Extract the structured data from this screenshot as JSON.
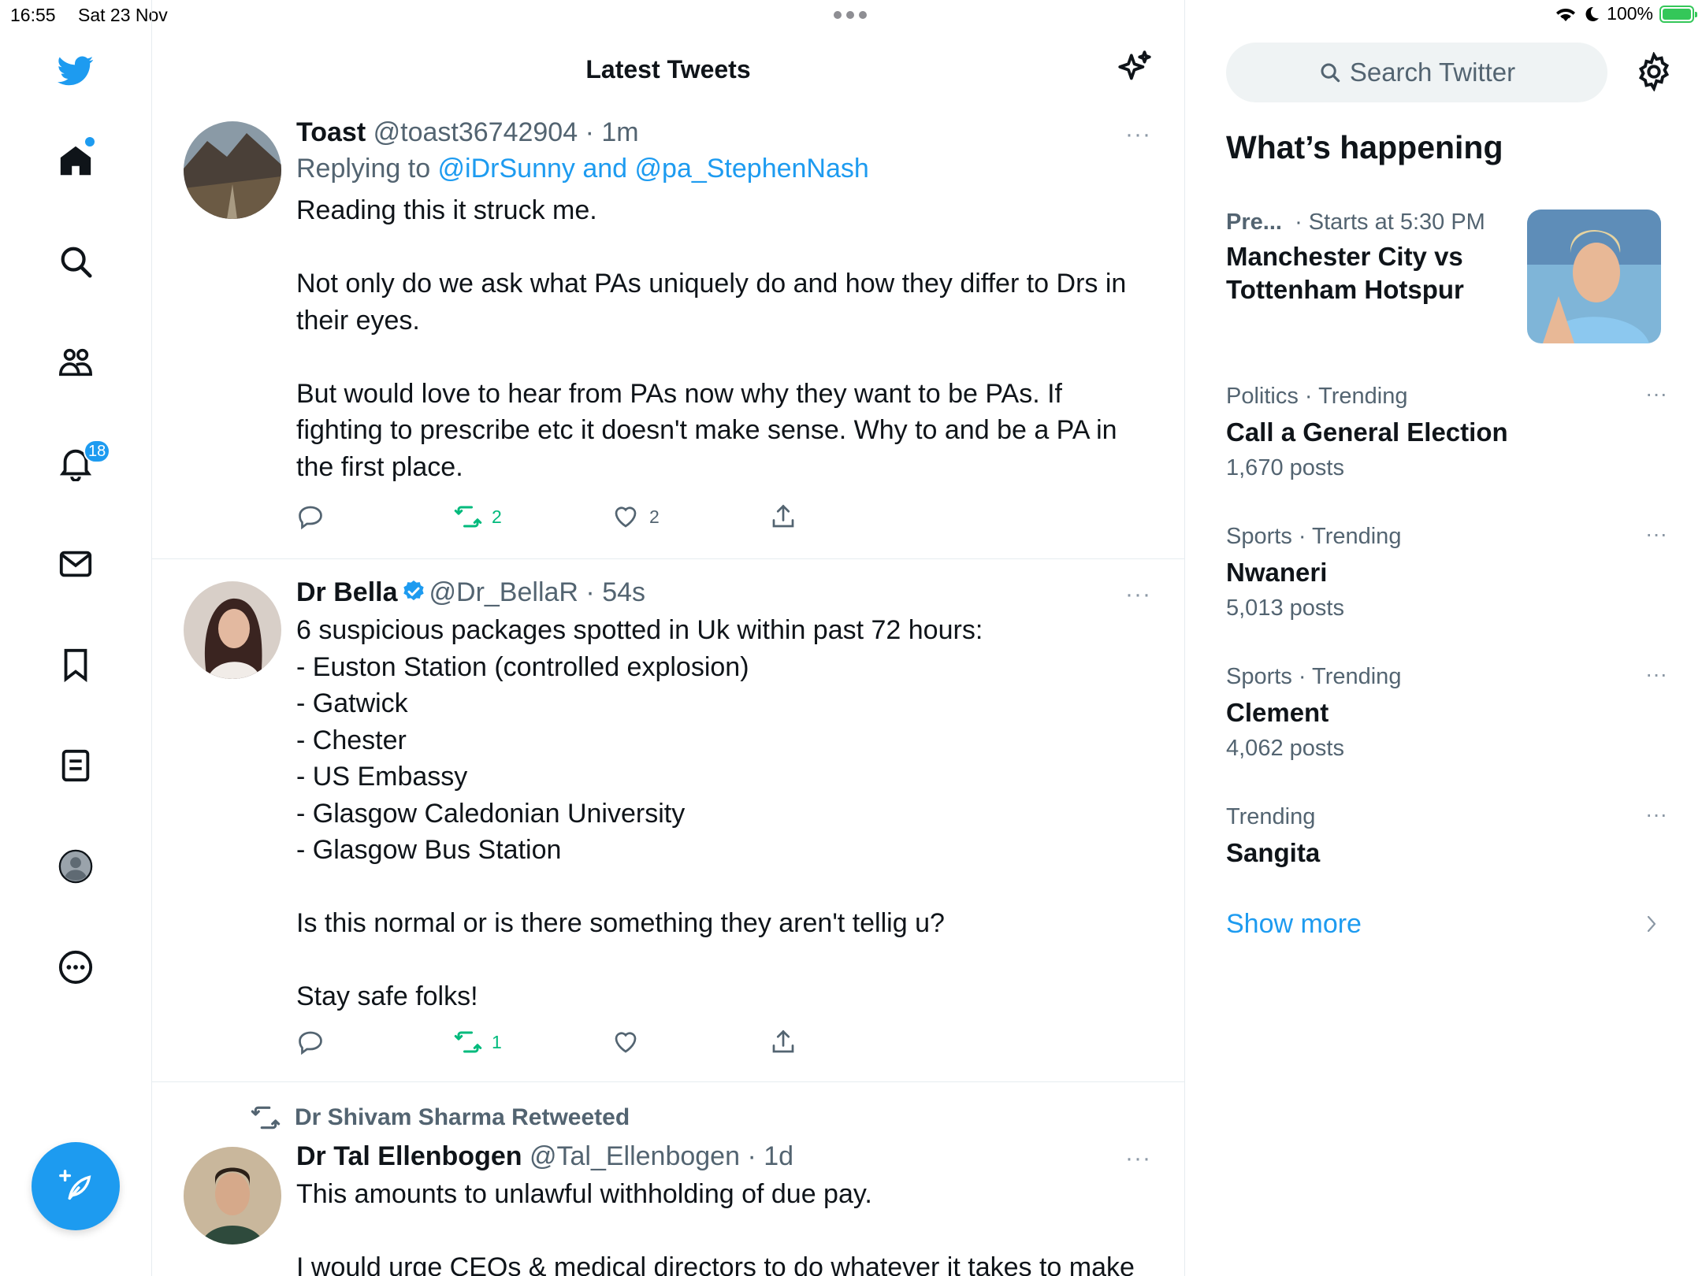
{
  "status_bar": {
    "time": "16:55",
    "date": "Sat 23 Nov",
    "battery": "100%",
    "battery_level": 1.0
  },
  "nav": {
    "notifications_badge": "18",
    "items": [
      "twitter-logo",
      "home-icon",
      "search-icon",
      "communities-icon",
      "notifications-icon",
      "messages-icon",
      "bookmarks-icon",
      "lists-icon",
      "profile-icon",
      "more-icon"
    ]
  },
  "timeline": {
    "title": "Latest Tweets",
    "tweets": [
      {
        "name": "Toast",
        "handle": "@toast36742904",
        "time": "· 1m",
        "more": "···",
        "replying_prefix": "Replying to ",
        "replying_to": "@iDrSunny and @pa_StephenNash",
        "text": "Reading this it struck me.\n\nNot only do we ask what PAs uniquely do and how they differ to Drs in their eyes.\n\nBut would love to hear from PAs now why they want to be PAs. If fighting to prescribe etc it doesn't make sense. Why to and be a PA in the first place.",
        "retweets": "2",
        "likes": "2"
      },
      {
        "name": "Dr Bella",
        "verified": true,
        "handle": "@Dr_BellaR",
        "time": "· 54s",
        "more": "···",
        "text": "6 suspicious packages spotted in Uk within past 72 hours:\n- Euston Station (controlled explosion)\n- Gatwick\n- Chester\n- US Embassy\n- Glasgow Caledonian University\n- Glasgow Bus Station\n\nIs this normal or is there something they aren't tellig u?\n\nStay safe folks!",
        "retweets": "1",
        "likes": ""
      },
      {
        "retweeted_by": "Dr Shivam Sharma Retweeted",
        "name": "Dr Tal Ellenbogen",
        "handle": "@Tal_Ellenbogen",
        "time": "· 1d",
        "more": "···",
        "text": "This amounts to unlawful withholding of due pay.\n\nI would urge CEOs & medical directors to do whatever it takes to make"
      }
    ]
  },
  "sidebar": {
    "search_placeholder": "Search Twitter",
    "whats_happening": "What’s happening",
    "event": {
      "category": "Pre...",
      "starts": "· Starts at 5:30 PM",
      "title": "Manchester City vs Tottenham Hotspur"
    },
    "trends": [
      {
        "category": "Politics · Trending",
        "name": "Call a General Election",
        "posts": "1,670 posts"
      },
      {
        "category": "Sports · Trending",
        "name": "Nwaneri",
        "posts": "5,013 posts"
      },
      {
        "category": "Sports · Trending",
        "name": "Clement",
        "posts": "4,062 posts"
      },
      {
        "category": "Trending",
        "name": "Sangita",
        "posts": ""
      }
    ],
    "more_glyph": "···",
    "show_more": "Show more"
  },
  "colors": {
    "accent": "#1d9bf0",
    "retweet": "#00ba7c",
    "secondary_text": "#536471"
  }
}
